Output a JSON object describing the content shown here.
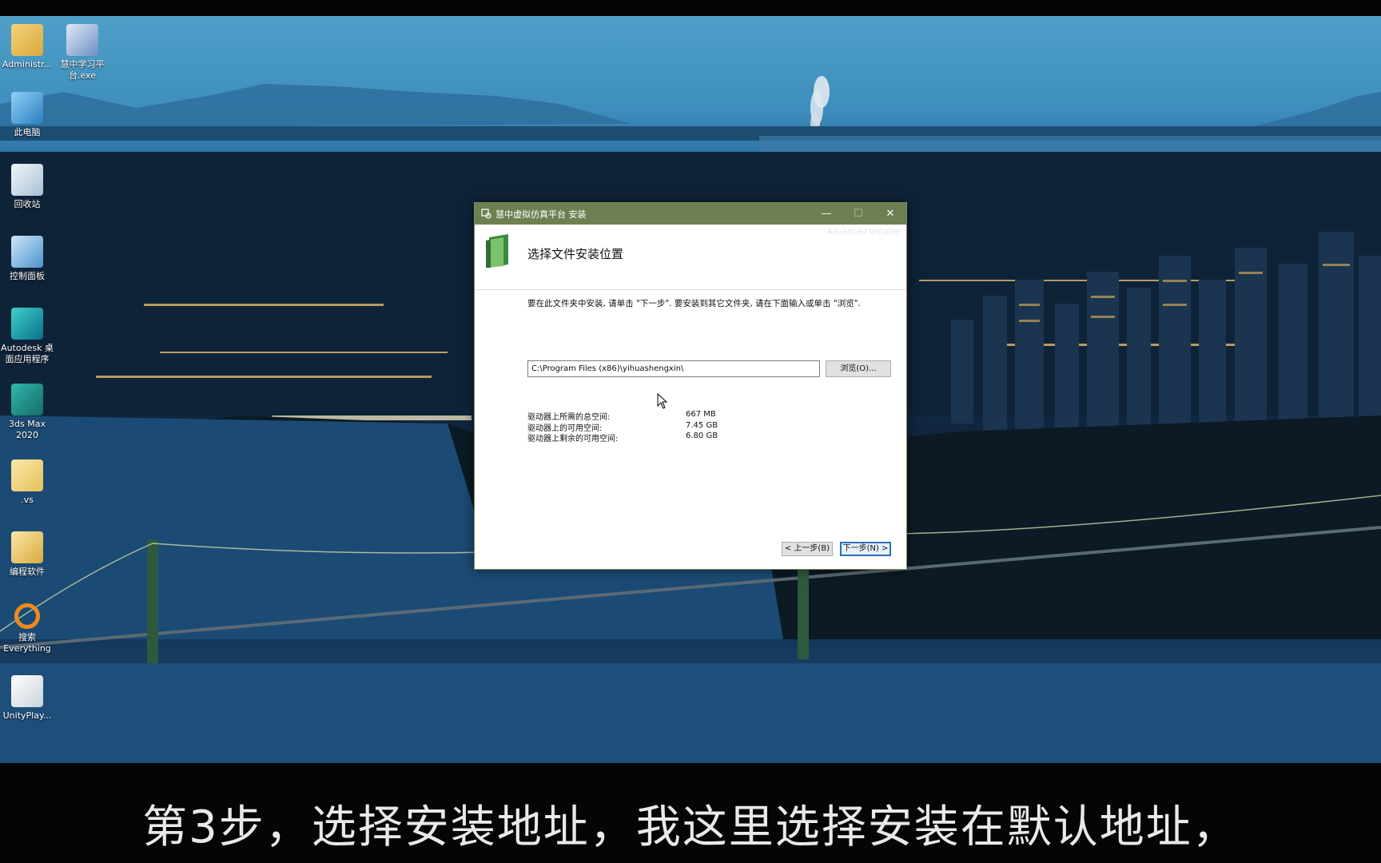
{
  "desktop_icons": [
    {
      "label": "Administr...",
      "icon": "user-folder-icon"
    },
    {
      "label": "慧中学习平台.exe",
      "icon": "app-shortcut-icon"
    },
    {
      "label": "此电脑",
      "icon": "computer-icon"
    },
    {
      "label": "回收站",
      "icon": "recycle-bin-icon"
    },
    {
      "label": "控制面板",
      "icon": "control-panel-icon"
    },
    {
      "label": "Autodesk 桌面应用程序",
      "icon": "autodesk-icon"
    },
    {
      "label": "3ds Max 2020",
      "icon": "3ds-max-icon"
    },
    {
      "label": ".vs",
      "icon": "folder-icon"
    },
    {
      "label": "编程软件",
      "icon": "folder-icon"
    },
    {
      "label": "搜索 Everything",
      "icon": "everything-search-icon"
    },
    {
      "label": "UnityPlay...",
      "icon": "settings-file-icon"
    }
  ],
  "window": {
    "title": "慧中虚拟仿真平台 安装",
    "watermark": "Advanced Installer",
    "heading": "选择文件安装位置",
    "description": "要在此文件夹中安装, 请单击 \"下一步\". 要安装到其它文件夹, 请在下面输入或单击 \"浏览\".",
    "install_path": "C:\\Program Files (x86)\\yihuashengxin\\",
    "browse_label": "浏览(O)...",
    "space": [
      {
        "label": "驱动器上所需的总空间:",
        "value": "667 MB"
      },
      {
        "label": "驱动器上的可用空间:",
        "value": "7.45 GB"
      },
      {
        "label": "驱动器上剩余的可用空间:",
        "value": "6.80 GB"
      }
    ],
    "back_label": "< 上一步(B)",
    "next_label": "下一步(N) >",
    "minimize_glyph": "—",
    "maximize_glyph": "☐",
    "close_glyph": "✕"
  },
  "subtitle": "第3步，选择安装地址，我这里选择安装在默认地址，"
}
